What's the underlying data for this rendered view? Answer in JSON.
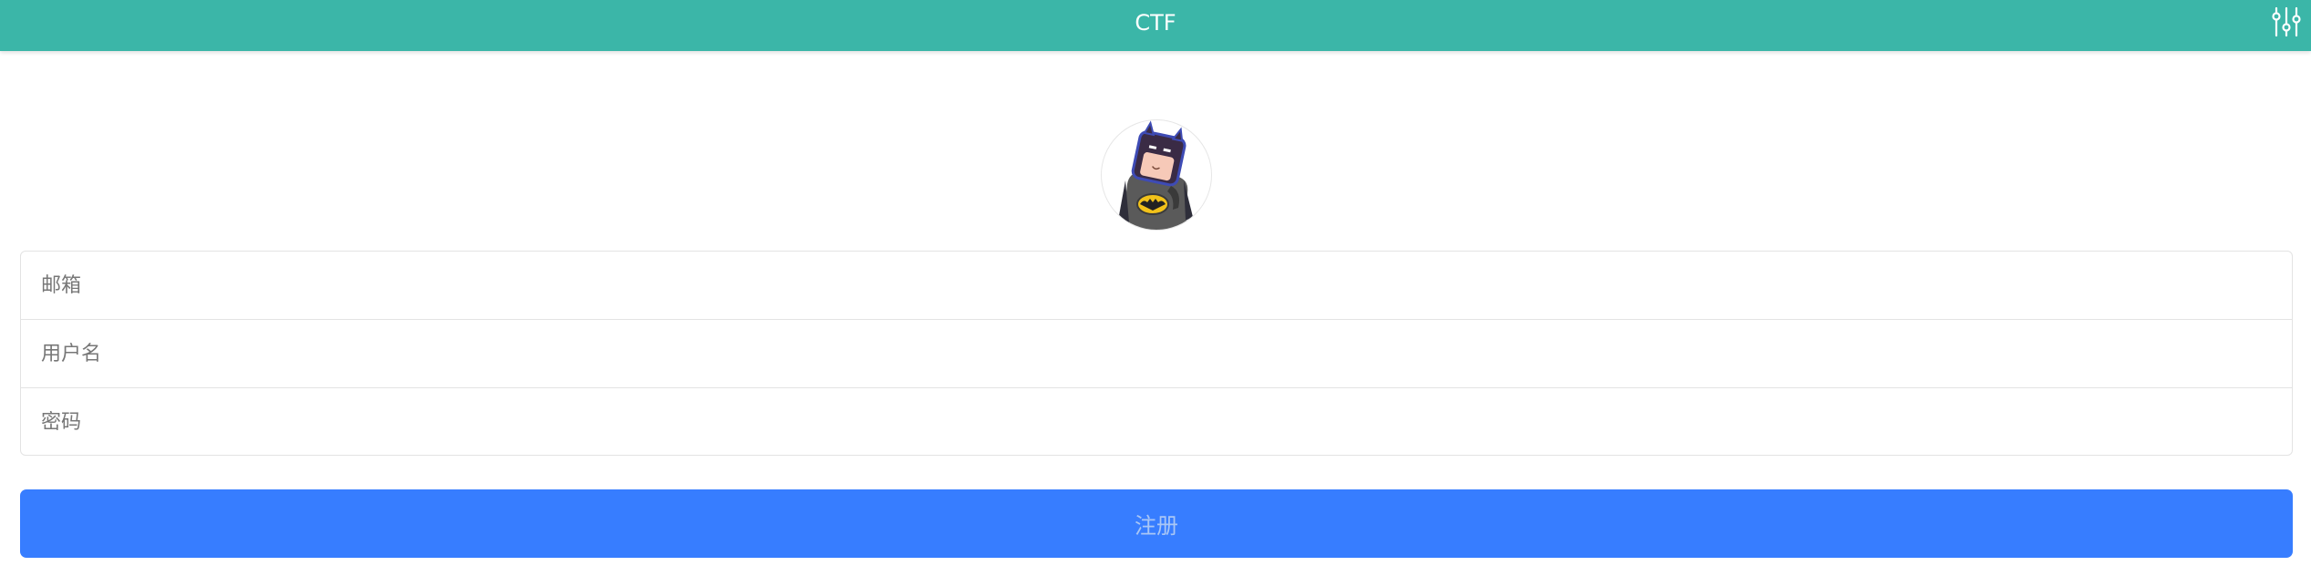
{
  "header": {
    "title": "CTF",
    "settings_icon": "sliders-icon",
    "background_color": "#3bb6a8"
  },
  "avatar": {
    "icon": "batman-avatar-icon"
  },
  "form": {
    "email_placeholder": "邮箱",
    "username_placeholder": "用户名",
    "password_placeholder": "密码",
    "submit_label": "注册",
    "submit_color": "#377dff"
  }
}
